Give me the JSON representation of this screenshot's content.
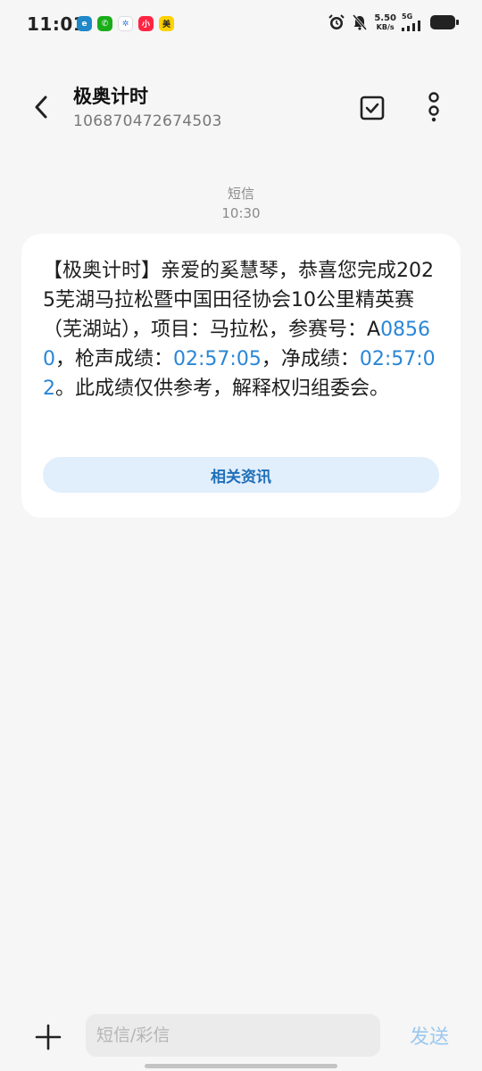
{
  "status_bar": {
    "time": "11:01",
    "speed_value": "5.50",
    "speed_unit": "KB/s",
    "network": "5G",
    "app_icons": [
      {
        "name": "browser-app-icon",
        "color": "#1e88c8",
        "glyph": "e"
      },
      {
        "name": "wechat-app-icon",
        "color": "#1aad19",
        "glyph": "✆"
      },
      {
        "name": "pinwheel-app-icon",
        "color": "#ffffff",
        "glyph": "✲"
      },
      {
        "name": "xiaohongshu-app-icon",
        "color": "#ff2442",
        "glyph": "小"
      },
      {
        "name": "meituan-app-icon",
        "color": "#ffd100",
        "glyph": "美"
      }
    ]
  },
  "header": {
    "contact_name": "极奥计时",
    "contact_number": "106870472674503"
  },
  "message": {
    "type_label": "短信",
    "time": "10:30",
    "segments": [
      {
        "text": "【极奥计时】亲爱的奚慧琴，恭喜您完成2025芜湖马拉松暨中国田径协会10公里精英赛（芜湖站），项目：马拉松，参赛号：A",
        "link": false
      },
      {
        "text": "08560",
        "link": true
      },
      {
        "text": "，枪声成绩：",
        "link": false
      },
      {
        "text": "02:57:05",
        "link": true
      },
      {
        "text": "，净成绩：",
        "link": false
      },
      {
        "text": "02:57:02",
        "link": true
      },
      {
        "text": "。此成绩仅供参考，解释权归组委会。",
        "link": false
      }
    ],
    "related_button": "相关资讯"
  },
  "composer": {
    "placeholder": "短信/彩信",
    "send_label": "发送"
  },
  "colors": {
    "link": "#2a86d6",
    "send_disabled": "#9cc8ee",
    "bubble": "#ffffff",
    "background": "#f6f6f6"
  }
}
